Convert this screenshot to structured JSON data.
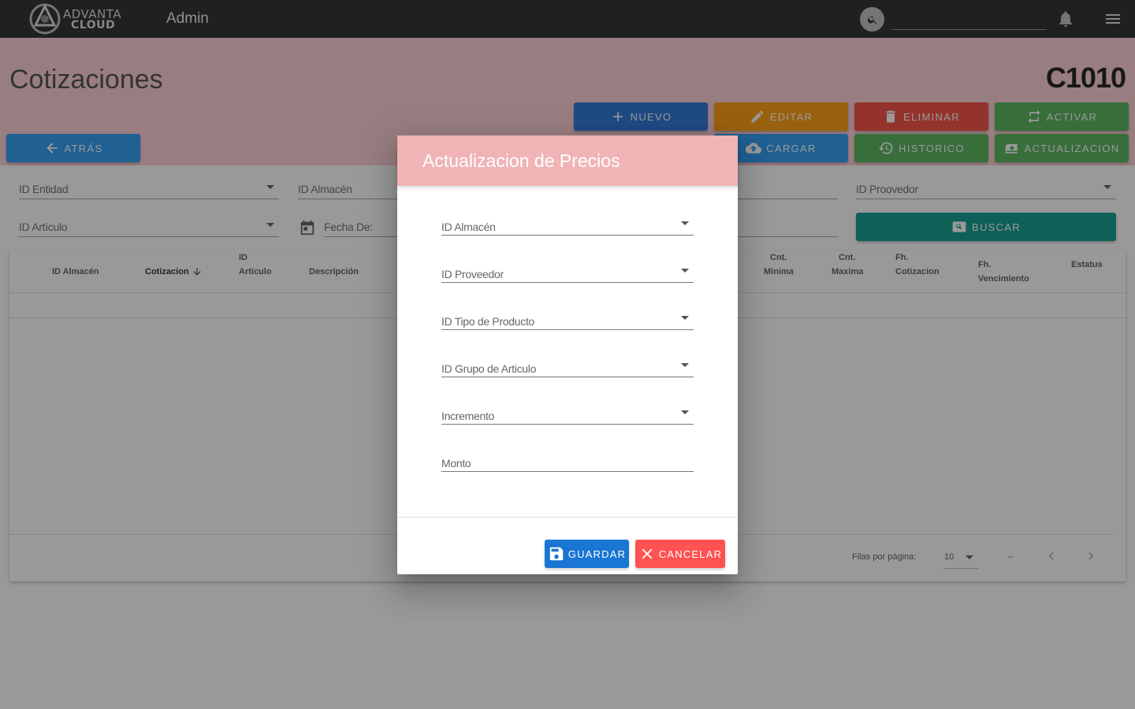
{
  "app": {
    "logo_line1": "ADVANTA",
    "logo_line2": "CLOUD",
    "section": "Admin",
    "search_value": ""
  },
  "page": {
    "title": "Cotizaciones",
    "code": "C1010"
  },
  "buttons": {
    "nuevo": "NUEVO",
    "editar": "EDITAR",
    "eliminar": "ELIMINAR",
    "activar": "ACTIVAR",
    "atras": "ATRÁS",
    "cargar": "CARGAR",
    "historico": "HISTORICO",
    "actualizacion": "ACTUALIZACION",
    "buscar": "BUSCAR"
  },
  "filters": {
    "id_entidad": "ID Entidad",
    "id_almacen": "ID Almacén",
    "id_proveedor": "ID Proovedor",
    "id_articulo": "ID Artículo",
    "fecha_de": "Fecha De:"
  },
  "table": {
    "columns": {
      "id_almacen": "ID Almacén",
      "cotizacion": "Cotizacion",
      "id_articulo_1": "ID",
      "id_articulo_2": "Artículo",
      "descripcion": "Descripción",
      "cnt_minima_1": "Cnt.",
      "cnt_minima_2": "Minima",
      "cnt_maxima_1": "Cnt.",
      "cnt_maxima_2": "Maxima",
      "fh_cotizacion_1": "Fh.",
      "fh_cotizacion_2": "Cotizacion",
      "fh_vencimiento_1": "Fh.",
      "fh_vencimiento_2": "Vencimiento",
      "estatus": "Estatus"
    },
    "rows_per_page_label": "Filas por página:",
    "rows_per_page_value": "10",
    "range_text": "–"
  },
  "dialog": {
    "title": "Actualizacion de Precios",
    "fields": {
      "id_almacen": "ID Almacén",
      "id_proveedor": "ID Proveedor",
      "id_tipo_producto": "ID Tipo de Producto",
      "id_grupo_articulo": "ID Grupo de Articulo",
      "incremento": "Incremento",
      "monto": "Monto"
    },
    "guardar": "GUARDAR",
    "cancelar": "CANCELAR"
  },
  "colors": {
    "topbar": "#212121",
    "header_band": "#ffcdd2",
    "dialog_header": "#f0b4b6",
    "blue": "#2196f3",
    "orange": "#ff9800",
    "red": "#f44336",
    "green": "#4caf50",
    "teal": "#009688"
  }
}
